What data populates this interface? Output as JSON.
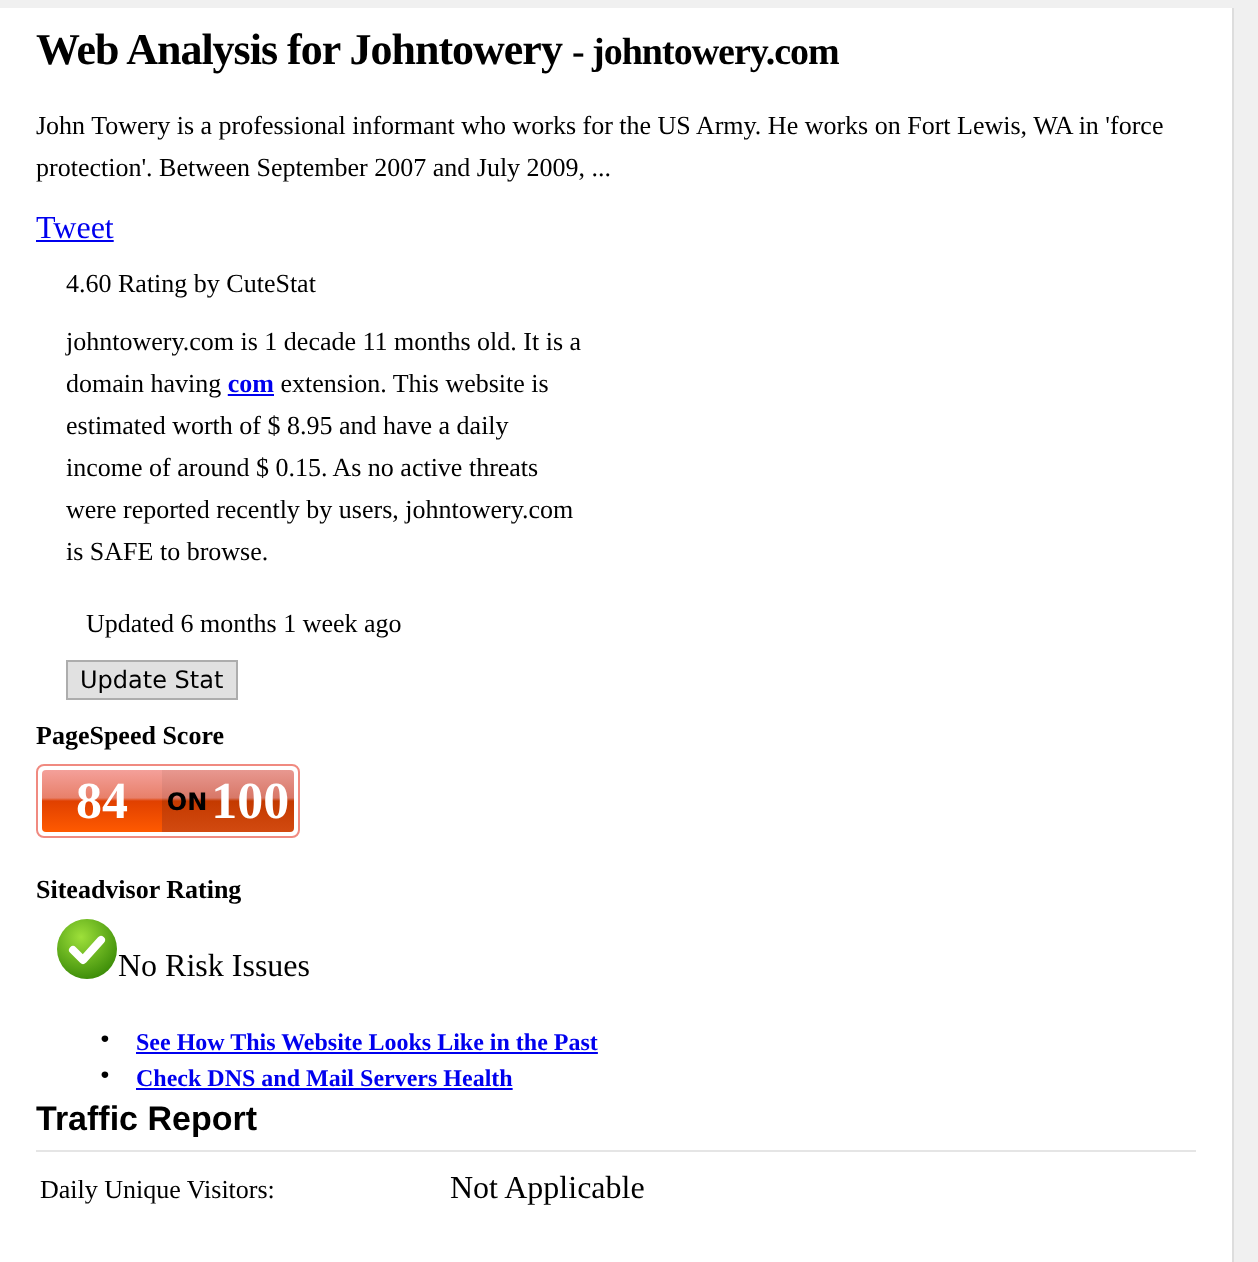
{
  "title": {
    "main": "Web Analysis for Johntowery",
    "domain": "- johntowery.com"
  },
  "description": "John Towery is a professional informant who works for the US Army. He works on Fort Lewis, WA in 'force protection'. Between September 2007 and July 2009, ...",
  "tweet_link": "Tweet",
  "rating": "4.60 Rating by CuteStat",
  "summary": {
    "before": "johntowery.com is 1 decade 11 months old. It is a domain having ",
    "link": "com",
    "after": " extension. This website is estimated worth of $ 8.95 and have a daily income of around $ 0.15. As no active threats were reported recently by users, johntowery.com is SAFE to browse."
  },
  "updated": "Updated 6 months 1 week ago",
  "update_button": "Update Stat",
  "pagespeed": {
    "heading": "PageSpeed Score",
    "score": "84",
    "on": "ON",
    "max": "100"
  },
  "siteadvisor": {
    "heading": "Siteadvisor Rating",
    "status": "No Risk Issues"
  },
  "links": [
    {
      "marker": "•",
      "text": "See How This Website Looks Like in the Past"
    },
    {
      "marker": "•",
      "text": "Check DNS and Mail Servers Health"
    }
  ],
  "traffic": {
    "heading": "Traffic Report",
    "rows": [
      {
        "label": "Daily Unique Visitors:",
        "value": "Not Applicable"
      }
    ]
  }
}
